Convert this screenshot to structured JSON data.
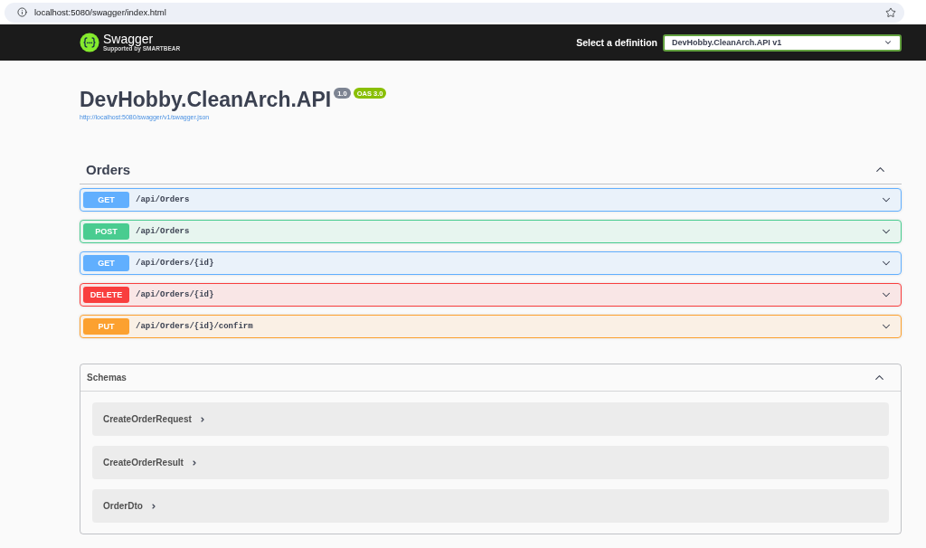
{
  "browser": {
    "url": "localhost:5080/swagger/index.html"
  },
  "topbar": {
    "logo": {
      "name": "Swagger",
      "tagline": "Supported by SMARTBEAR"
    },
    "definition_label": "Select a definition",
    "definition_select": {
      "value": "DevHobby.CleanArch.API v1"
    }
  },
  "info": {
    "title": "DevHobby.CleanArch.API",
    "badges": [
      {
        "label": "1.0",
        "kind": "version"
      },
      {
        "label": "OAS 3.0",
        "kind": "spec"
      }
    ],
    "spec_link": "http://localhost:5080/swagger/v1/swagger.json"
  },
  "tag": {
    "name": "Orders",
    "expanded": true,
    "operations": [
      {
        "method": "GET",
        "path": "/api/Orders",
        "color": "#61affe",
        "expanded": false
      },
      {
        "method": "POST",
        "path": "/api/Orders",
        "color": "#49cc90",
        "expanded": false
      },
      {
        "method": "GET",
        "path": "/api/Orders/{id}",
        "color": "#61affe",
        "expanded": false
      },
      {
        "method": "DELETE",
        "path": "/api/Orders/{id}",
        "color": "#f93e3e",
        "expanded": false
      },
      {
        "method": "PUT",
        "path": "/api/Orders/{id}/confirm",
        "color": "#fca130",
        "expanded": false
      }
    ]
  },
  "schemas": {
    "title": "Schemas",
    "expanded": true,
    "items": [
      {
        "name": "CreateOrderRequest",
        "expanded": false
      },
      {
        "name": "CreateOrderResult",
        "expanded": false
      },
      {
        "name": "OrderDto",
        "expanded": false
      }
    ]
  }
}
